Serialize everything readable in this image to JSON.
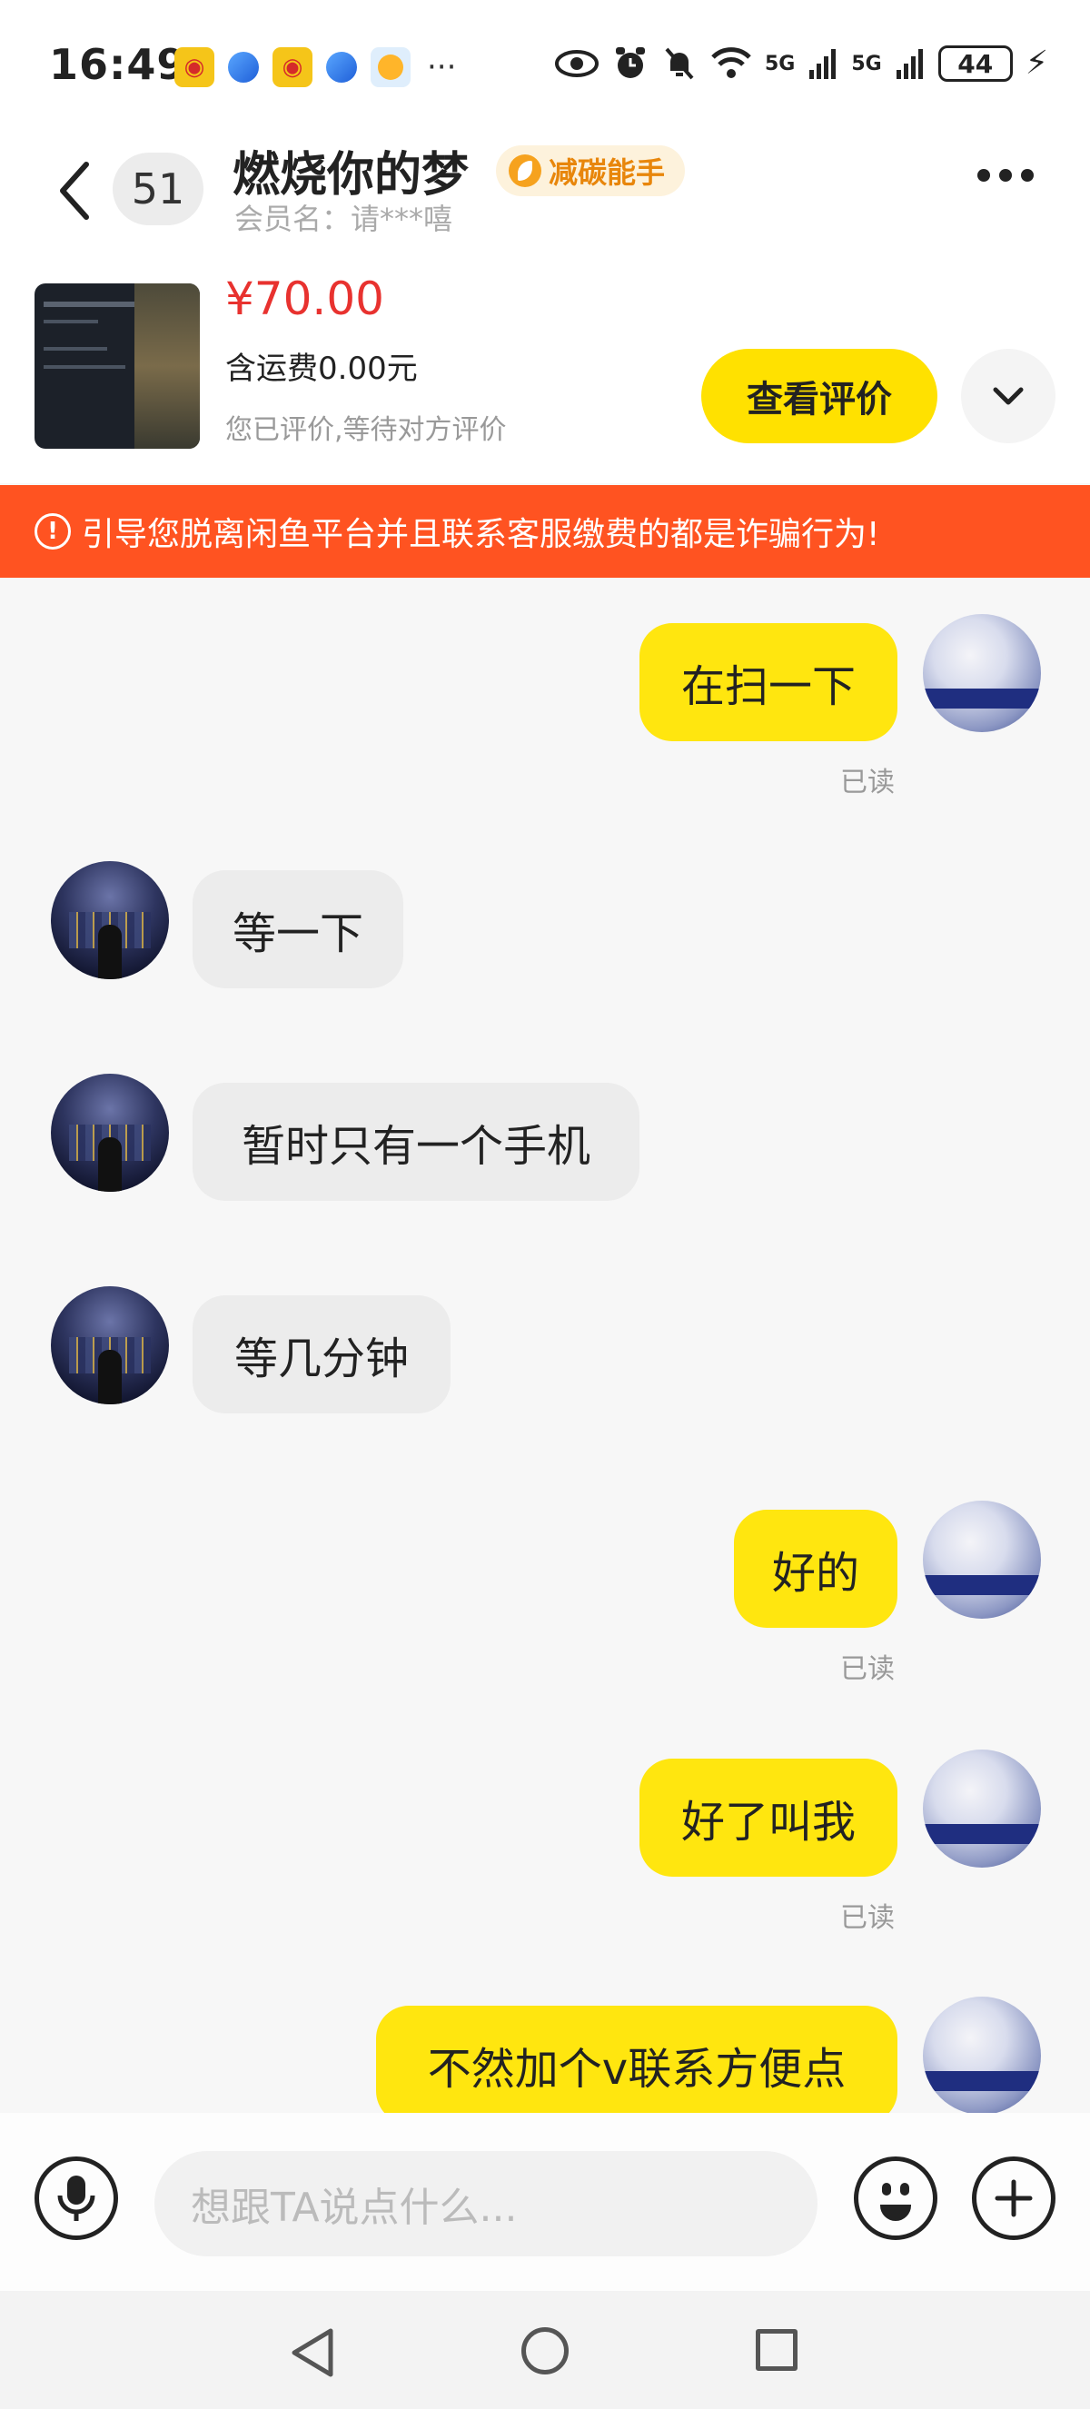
{
  "status_bar": {
    "time": "16:49",
    "app_icons": [
      "weibo-icon",
      "browser-icon",
      "weibo-icon",
      "browser-icon",
      "weather-icon"
    ],
    "more": "···",
    "network_1": "5G",
    "network_2": "5G",
    "battery": "44"
  },
  "header": {
    "unread_count": "51",
    "contact_name": "燃烧你的梦",
    "badge": "减碳能手",
    "member_name": "会员名：请***嘻"
  },
  "product": {
    "price": "¥70.00",
    "shipping": "含运费0.00元",
    "status": "您已评价,等待对方评价",
    "review_button": "查看评价"
  },
  "warning": {
    "text": "引导您脱离闲鱼平台并且联系客服缴费的都是诈骗行为!"
  },
  "messages": [
    {
      "from": "me",
      "text": "在扫一下",
      "status": "已读"
    },
    {
      "from": "other",
      "text": "等一下"
    },
    {
      "from": "other",
      "text": "暂时只有一个手机"
    },
    {
      "from": "other",
      "text": "等几分钟"
    },
    {
      "from": "me",
      "text": "好的",
      "status": "已读"
    },
    {
      "from": "me",
      "text": "好了叫我",
      "status": "已读"
    },
    {
      "from": "me",
      "text": "不然加个v联系方便点"
    }
  ],
  "input": {
    "placeholder": "想跟TA说点什么..."
  },
  "colors": {
    "accent": "#ffe100",
    "warning": "#ff5321",
    "price": "#e8322f"
  }
}
